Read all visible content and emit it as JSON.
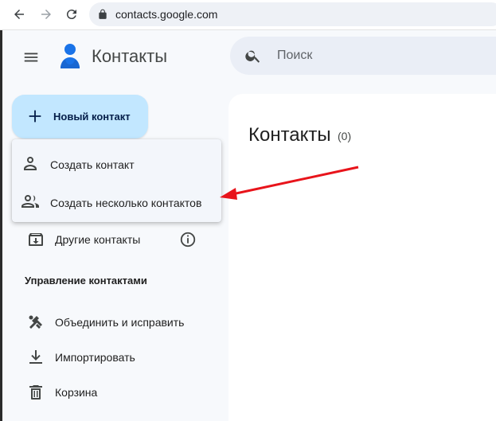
{
  "browser": {
    "url": "contacts.google.com",
    "back_icon": "arrow-left-icon",
    "forward_icon": "arrow-right-icon",
    "reload_icon": "reload-icon"
  },
  "header": {
    "app_title": "Контакты",
    "search_placeholder": "Поиск"
  },
  "sidebar": {
    "new_contact_label": "Новый контакт",
    "menu": [
      {
        "label": "Создать контакт",
        "icon": "person-icon"
      },
      {
        "label": "Создать несколько контактов",
        "icon": "people-icon"
      }
    ],
    "other_contacts_label": "Другие контакты",
    "section_title": "Управление контактами",
    "manage_items": [
      {
        "label": "Объединить и исправить",
        "icon": "merge-tools-icon"
      },
      {
        "label": "Импортировать",
        "icon": "import-icon"
      },
      {
        "label": "Корзина",
        "icon": "trash-icon"
      }
    ]
  },
  "main": {
    "title": "Контакты",
    "count": "(0)"
  },
  "colors": {
    "accent_button": "#c2e7ff",
    "annotation_arrow": "#e8141b",
    "logo_blue": "#1a73e8"
  }
}
